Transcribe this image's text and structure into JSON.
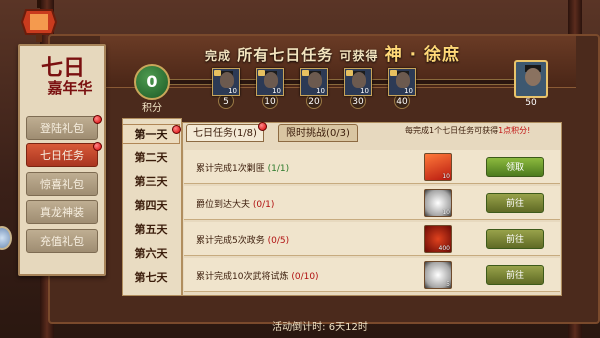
{
  "header": {
    "prefix": "完成",
    "mid": "所有七日任务",
    "suffix": "可获得",
    "highlight": "神 · 徐庶"
  },
  "banner": {
    "title_line1": "七日",
    "title_line2": "嘉年华"
  },
  "gift_menu": [
    {
      "label": "登陆礼包",
      "active": false,
      "badge": true
    },
    {
      "label": "七日任务",
      "active": true,
      "badge": true
    },
    {
      "label": "惊喜礼包",
      "active": false,
      "badge": false
    },
    {
      "label": "真龙神装",
      "active": false,
      "badge": false
    },
    {
      "label": "充值礼包",
      "active": false,
      "badge": false
    }
  ],
  "progress": {
    "points_value": "0",
    "points_label": "积分",
    "milestones": [
      "5",
      "10",
      "20",
      "30",
      "40",
      "50"
    ],
    "reward_counts": [
      "10",
      "10",
      "10",
      "10",
      "10"
    ],
    "grand_reward_count": "50",
    "fraction": 0
  },
  "days": [
    "第一天",
    "第二天",
    "第三天",
    "第四天",
    "第五天",
    "第六天",
    "第七天"
  ],
  "active_day": 0,
  "tabs": [
    {
      "label": "七日任务(1/8)",
      "active": true,
      "badge": true
    },
    {
      "label": "限时挑战(0/3)",
      "active": false,
      "badge": false
    }
  ],
  "hint": {
    "text": "每完成1个七日任务可获得",
    "highlight": "1点积分!"
  },
  "tasks": [
    {
      "text": "累计完成1次剿匪",
      "progress": "(1/1)",
      "item_icon": "red-bag-icon",
      "item_count": "10",
      "button": "领取",
      "done": true
    },
    {
      "text": "爵位到达大夫",
      "progress": "(0/1)",
      "item_icon": "silver-ingot-icon",
      "item_count": "10",
      "button": "前往",
      "done": false
    },
    {
      "text": "累计完成5次政务",
      "progress": "(0/5)",
      "item_icon": "red-pouch-icon",
      "item_count": "400",
      "button": "前往",
      "done": false
    },
    {
      "text": "累计完成10次武将试炼",
      "progress": "(0/10)",
      "item_icon": "silver-ingot-icon",
      "item_count": "5",
      "button": "前往",
      "done": false
    }
  ],
  "footer": {
    "label": "活动倒计时: ",
    "time": "6天12时"
  },
  "colors": {
    "accent_red": "#c01010",
    "button_green": "#6a9a2e",
    "panel": "#e7d9bf"
  }
}
